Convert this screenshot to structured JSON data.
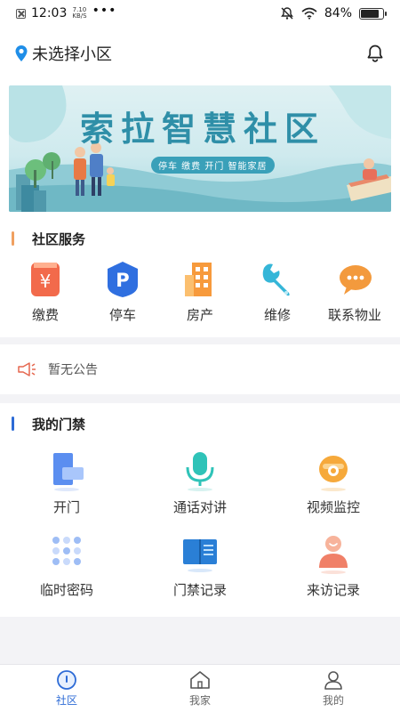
{
  "status_bar": {
    "time": "12:03",
    "speed_top": "7.10",
    "speed_unit": "KB/S",
    "dots": "•••",
    "battery_text": "84%",
    "battery_level": 0.84
  },
  "header": {
    "title": "未选择小区"
  },
  "banner": {
    "title": "索拉智慧社区",
    "subtitle": "停车  缴费  开门  智能家居"
  },
  "community_services": {
    "title": "社区服务",
    "items": [
      {
        "label": "缴费",
        "icon": "payment-icon"
      },
      {
        "label": "停车",
        "icon": "parking-icon"
      },
      {
        "label": "房产",
        "icon": "building-icon"
      },
      {
        "label": "维修",
        "icon": "wrench-icon"
      },
      {
        "label": "联系物业",
        "icon": "chat-icon"
      }
    ]
  },
  "notice": {
    "text": "暂无公告"
  },
  "access": {
    "title": "我的门禁",
    "items": [
      {
        "label": "开门",
        "icon": "door-open-icon"
      },
      {
        "label": "通话对讲",
        "icon": "microphone-icon"
      },
      {
        "label": "视频监控",
        "icon": "camera-icon"
      },
      {
        "label": "临时密码",
        "icon": "keypad-icon"
      },
      {
        "label": "门禁记录",
        "icon": "book-icon"
      },
      {
        "label": "来访记录",
        "icon": "visitor-icon"
      }
    ]
  },
  "tabbar": {
    "tabs": [
      {
        "label": "社区",
        "icon": "community-icon",
        "active": true
      },
      {
        "label": "我家",
        "icon": "home-icon",
        "active": false
      },
      {
        "label": "我的",
        "icon": "user-icon",
        "active": false
      }
    ]
  },
  "colors": {
    "accent_blue": "#2d6bd6",
    "section_bar_services": "#f0a060",
    "section_bar_access": "#2d6bd6",
    "banner_title": "#2f8fa8"
  }
}
